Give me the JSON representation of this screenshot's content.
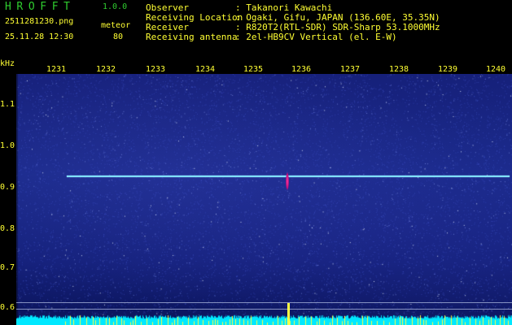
{
  "header": {
    "app_title": "HROFFT",
    "app_version": "1.0.0",
    "file_name": "2511281230.png",
    "mode": "meteor",
    "datetime": "25.11.28 12:30",
    "count": "80",
    "info": [
      {
        "label": "Observer",
        "value": ": Takanori Kawachi"
      },
      {
        "label": "Receiving Location",
        "value": ": Ogaki, Gifu, JAPAN (136.60E, 35.35N)"
      },
      {
        "label": "Receiver",
        "value": ": R820T2(RTL-SDR) SDR-Sharp 53.1000MHz"
      },
      {
        "label": "Receiving antenna",
        "value": ": 2el-HB9CV Vertical (el. E-W)"
      }
    ]
  },
  "axis": {
    "y_unit": "kHz",
    "y_ticks": [
      "1.1",
      "1.0",
      "0.9",
      "0.8",
      "0.7",
      "0.6"
    ],
    "x_ticks": [
      "1231",
      "1232",
      "1233",
      "1234",
      "1235",
      "1236",
      "1237",
      "1238",
      "1239",
      "1240"
    ]
  },
  "colors": {
    "header_text": "#ffff33",
    "title_green": "#2fcd2f",
    "background_blue": "#1a2a8a",
    "carrier": "#7fe0ff",
    "meteor_echo": "#ff3aa0",
    "power_trace": "#00ffff"
  }
}
